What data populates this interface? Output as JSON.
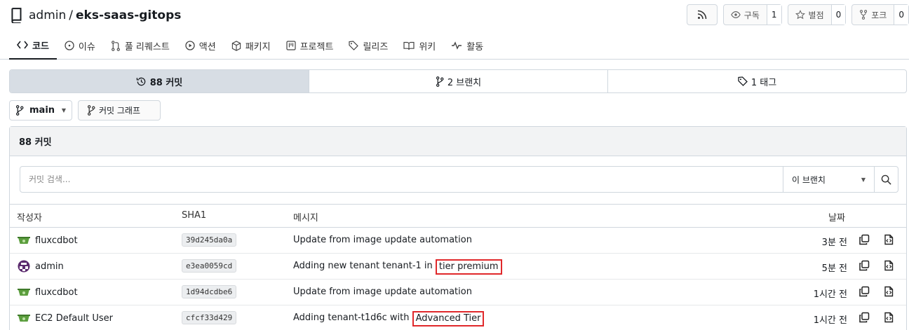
{
  "repo": {
    "owner": "admin",
    "separator": "/",
    "name": "eks-saas-gitops"
  },
  "actions": [
    {
      "label": "구독",
      "count": "1",
      "icon": "eye-icon"
    },
    {
      "label": "별점",
      "count": "0",
      "icon": "star-icon"
    },
    {
      "label": "포크",
      "count": "0",
      "icon": "fork-icon"
    }
  ],
  "tabs": [
    {
      "label": "코드",
      "icon": "code-icon",
      "active": true
    },
    {
      "label": "이슈",
      "icon": "issue-icon"
    },
    {
      "label": "풀 리퀘스트",
      "icon": "pull-request-icon"
    },
    {
      "label": "액션",
      "icon": "play-icon"
    },
    {
      "label": "패키지",
      "icon": "package-icon"
    },
    {
      "label": "프로젝트",
      "icon": "project-icon"
    },
    {
      "label": "릴리즈",
      "icon": "tag-icon"
    },
    {
      "label": "위키",
      "icon": "book-icon"
    },
    {
      "label": "활동",
      "icon": "pulse-icon"
    }
  ],
  "summary": {
    "commits": "88 커밋",
    "branches": "2 브랜치",
    "tags": "1 태그"
  },
  "branch_selector": {
    "label": "main",
    "graph_label": "커밋 그래프"
  },
  "panel": {
    "title": "88 커밋",
    "search_placeholder": "커밋 검색...",
    "scope": "이 브랜치"
  },
  "columns": {
    "author": "작성자",
    "sha": "SHA1",
    "message": "메시지",
    "date": "날짜"
  },
  "commits": [
    {
      "author": "fluxcdbot",
      "sha": "39d245da0a",
      "message": "Update from image update automation",
      "highlight": "",
      "date": "3분 전"
    },
    {
      "author": "admin",
      "sha": "e3ea0059cd",
      "message": "Adding new tenant tenant-1 in ",
      "highlight": "tier premium",
      "date": "5분 전"
    },
    {
      "author": "fluxcdbot",
      "sha": "1d94dcdbe6",
      "message": "Update from image update automation",
      "highlight": "",
      "date": "1시간 전"
    },
    {
      "author": "EC2 Default User",
      "sha": "cfcf33d429",
      "message": "Adding tenant-t1d6c with ",
      "highlight": "Advanced Tier",
      "date": "1시간 전"
    }
  ],
  "colors": {
    "accent": "#181c21",
    "highlight_border": "#e0282b",
    "active_segment": "#d7dde4"
  }
}
